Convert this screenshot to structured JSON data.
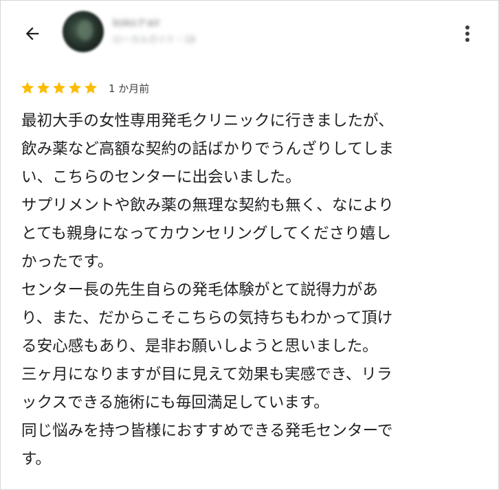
{
  "header": {
    "back_icon": "arrow-left-icon",
    "reviewer_name": "kokoナair",
    "reviewer_meta": "ローカルガイド・18",
    "more_icon": "more-vert-icon"
  },
  "review": {
    "rating": 5,
    "max_rating": 5,
    "star_color": "#fbbc04",
    "date": "1 か月前",
    "lines": [
      "最初大手の女性専用発毛クリニックに行きましたが、",
      "飲み薬など高額な契約の話ばかりでうんざりしてしま",
      "い、こちらのセンターに出会いました。",
      "サプリメントや飲み薬の無理な契約も無く、なにより",
      "とても親身になってカウンセリングしてくださり嬉し",
      "かったです。",
      "センター長の先生自らの発毛体験がとて説得力があ",
      "り、また、だからこそこちらの気持ちもわかって頂け",
      "る安心感もあり、是非お願いしようと思いました。",
      "三ヶ月になりますが目に見えて効果も実感でき、リラ",
      "ックスできる施術にも毎回満足しています。",
      "同じ悩みを持つ皆様におすすめできる発毛センターで",
      "す。"
    ]
  }
}
